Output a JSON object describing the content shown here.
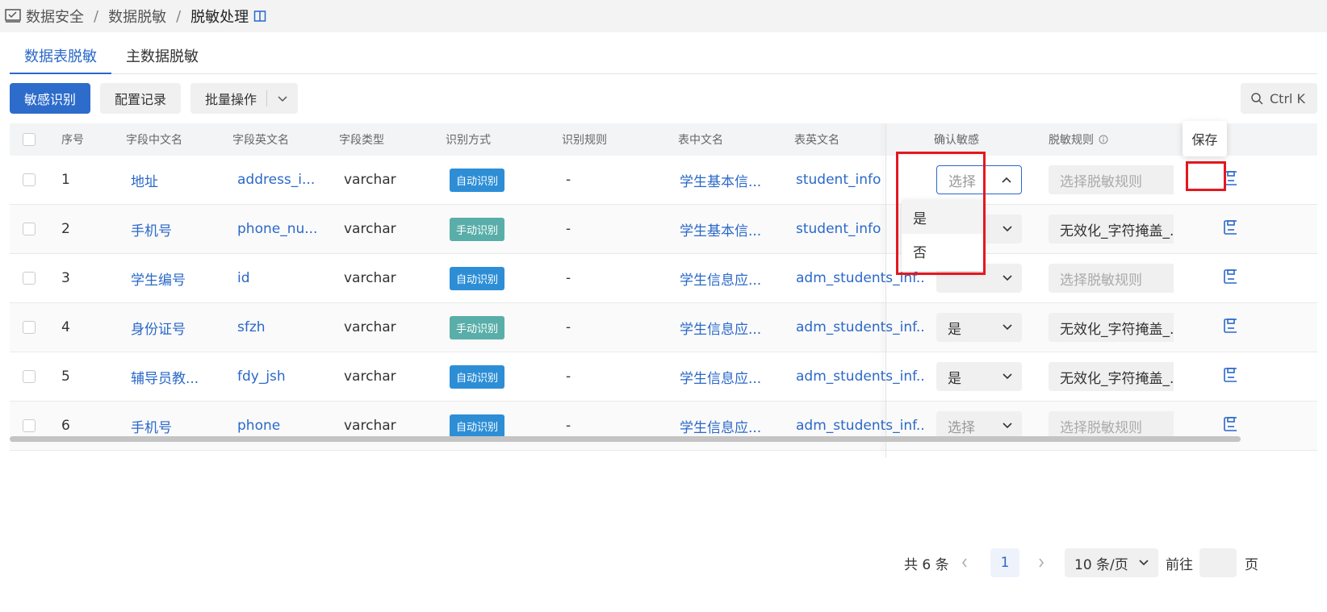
{
  "breadcrumb": [
    "数据安全",
    "数据脱敏",
    "脱敏处理"
  ],
  "tabs": [
    "数据表脱敏",
    "主数据脱敏"
  ],
  "toolbar": {
    "identify": "敏感识别",
    "records": "配置记录",
    "batch": "批量操作"
  },
  "search": {
    "shortcut": "Ctrl K"
  },
  "columns": [
    "序号",
    "字段中文名",
    "字段英文名",
    "字段类型",
    "识别方式",
    "识别规则",
    "表中文名",
    "表英文名",
    "确认敏感",
    "脱敏规则"
  ],
  "rows": [
    {
      "no": "1",
      "cn": "地址",
      "en": "address_i...",
      "type": "varchar",
      "method": "自动识别",
      "rule": "-",
      "tcn": "学生基本信...",
      "ten": "student_info",
      "confirm": "选择",
      "mask": "选择脱敏规则"
    },
    {
      "no": "2",
      "cn": "手机号",
      "en": "phone_nu...",
      "type": "varchar",
      "method": "手动识别",
      "rule": "-",
      "tcn": "学生基本信...",
      "ten": "student_info",
      "confirm": "",
      "mask": "无效化_字符掩盖_..."
    },
    {
      "no": "3",
      "cn": "学生编号",
      "en": "id",
      "type": "varchar",
      "method": "自动识别",
      "rule": "-",
      "tcn": "学生信息应...",
      "ten": "adm_students_inf...",
      "confirm": "",
      "mask": "选择脱敏规则"
    },
    {
      "no": "4",
      "cn": "身份证号",
      "en": "sfzh",
      "type": "varchar",
      "method": "手动识别",
      "rule": "-",
      "tcn": "学生信息应...",
      "ten": "adm_students_inf...",
      "confirm": "是",
      "mask": "无效化_字符掩盖_..."
    },
    {
      "no": "5",
      "cn": "辅导员教...",
      "en": "fdy_jsh",
      "type": "varchar",
      "method": "自动识别",
      "rule": "-",
      "tcn": "学生信息应...",
      "ten": "adm_students_inf...",
      "confirm": "是",
      "mask": "无效化_字符掩盖_..."
    },
    {
      "no": "6",
      "cn": "手机号",
      "en": "phone",
      "type": "varchar",
      "method": "自动识别",
      "rule": "-",
      "tcn": "学生信息应...",
      "ten": "adm_students_inf...",
      "confirm": "选择",
      "mask": "选择脱敏规则"
    }
  ],
  "dropdown": [
    "是",
    "否"
  ],
  "tooltip": "保存",
  "pager": {
    "total": "共 6 条",
    "page": "1",
    "size": "10 条/页",
    "goto": "前往",
    "unit": "页"
  }
}
